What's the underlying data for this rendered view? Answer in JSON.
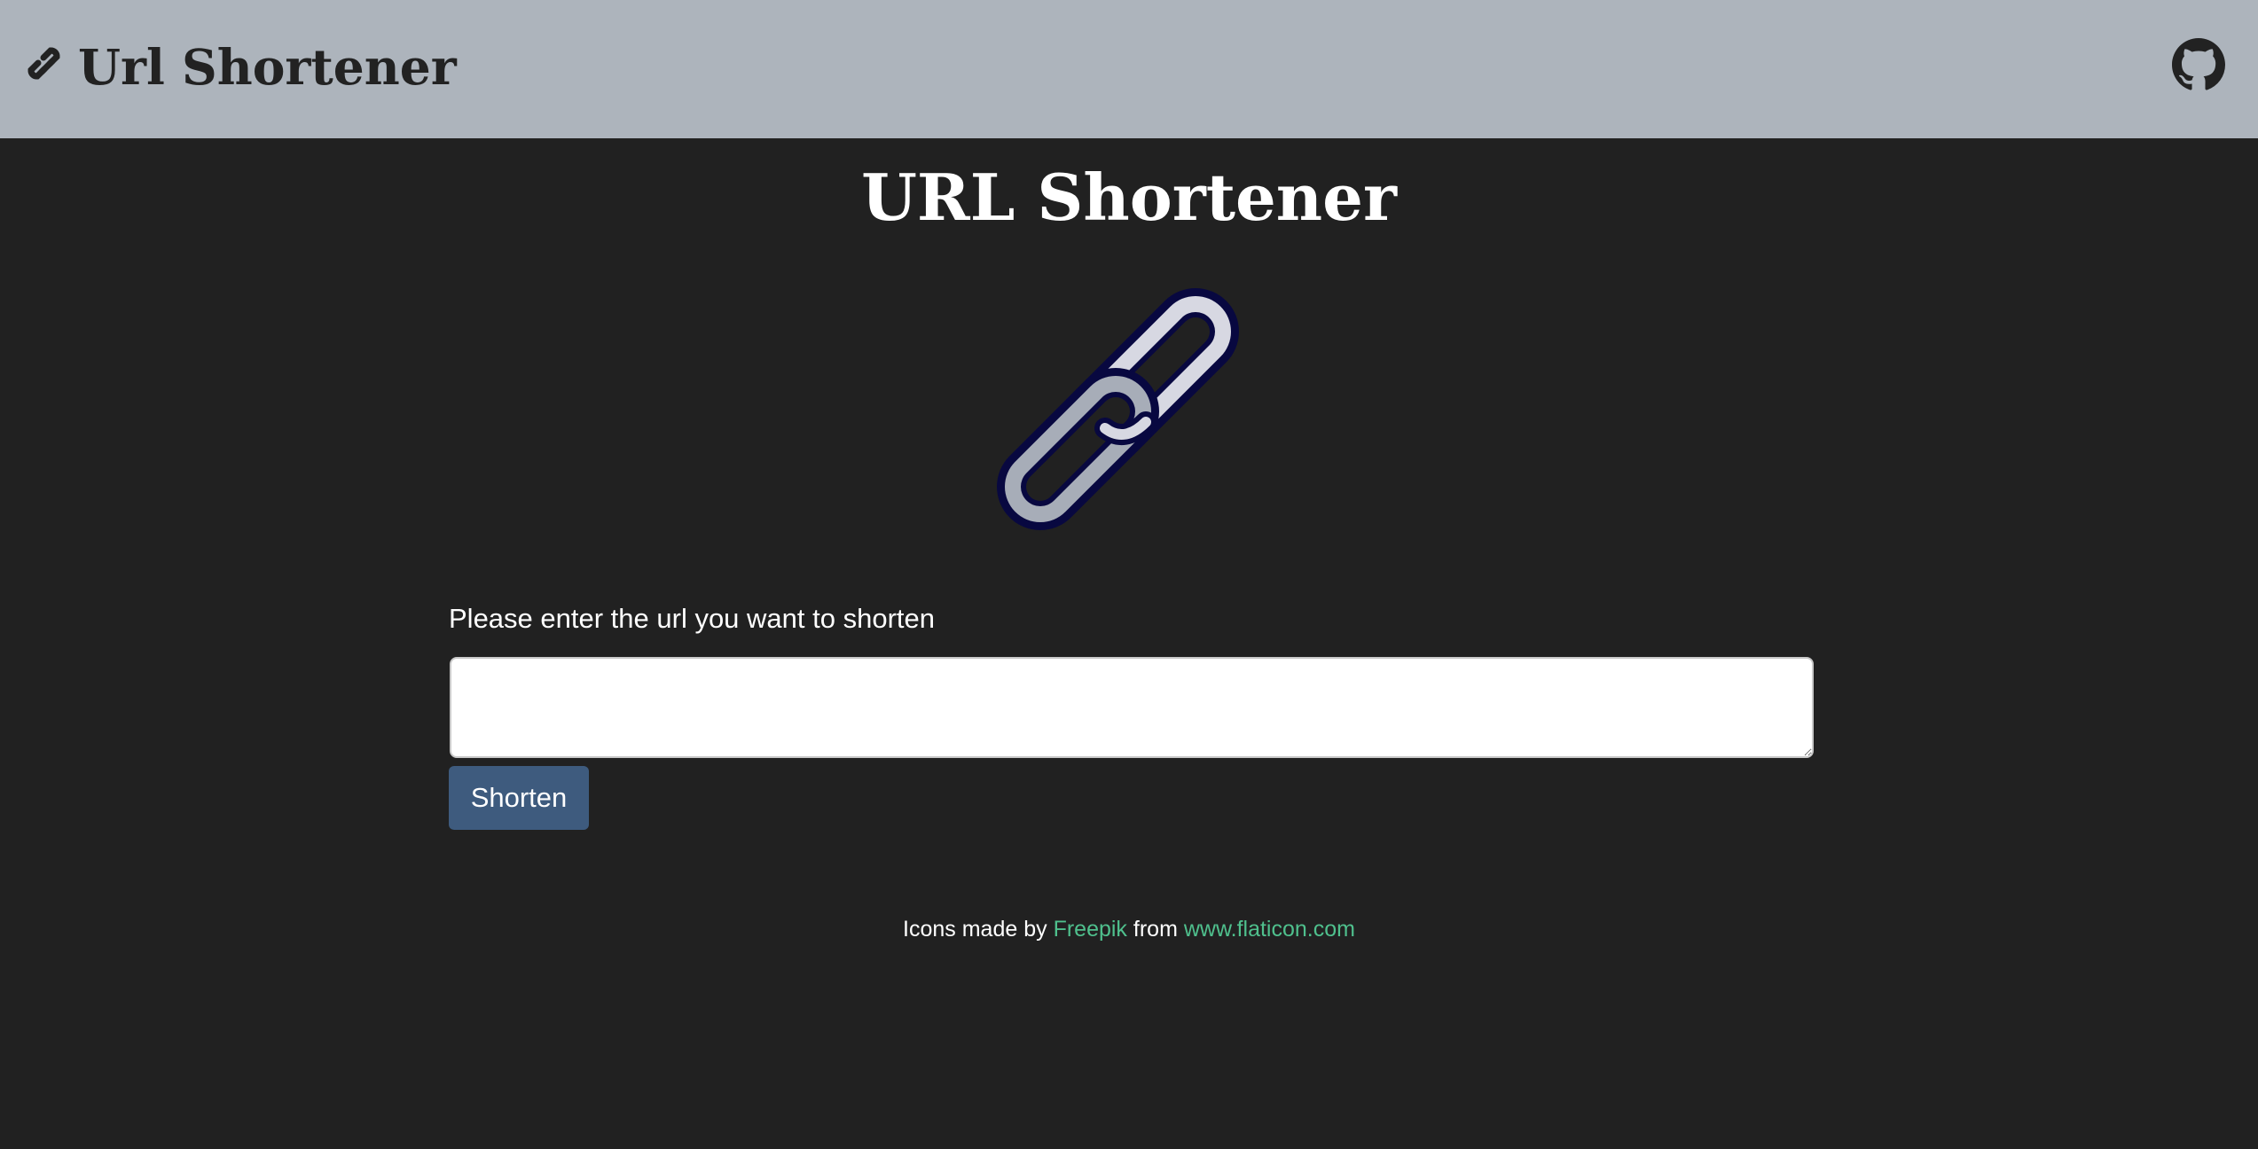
{
  "navbar": {
    "brand_icon": "link-icon",
    "brand_text": "Url Shortener",
    "github_icon": "github-icon",
    "background": "#adb4bc"
  },
  "main": {
    "title": "URL Shortener",
    "logo_icon": "chain-link-illustration",
    "input_label": "Please enter the url you want to shorten",
    "input_value": "",
    "input_placeholder": "",
    "submit_label": "Shorten",
    "button_color": "#3e5b7e"
  },
  "footer": {
    "credit_prefix": "Icons made by",
    "author_link": "Freepik",
    "credit_middle": "from",
    "site_link": "www.flaticon.com",
    "link_color": "#4fc08d"
  },
  "page": {
    "background": "#212121"
  }
}
